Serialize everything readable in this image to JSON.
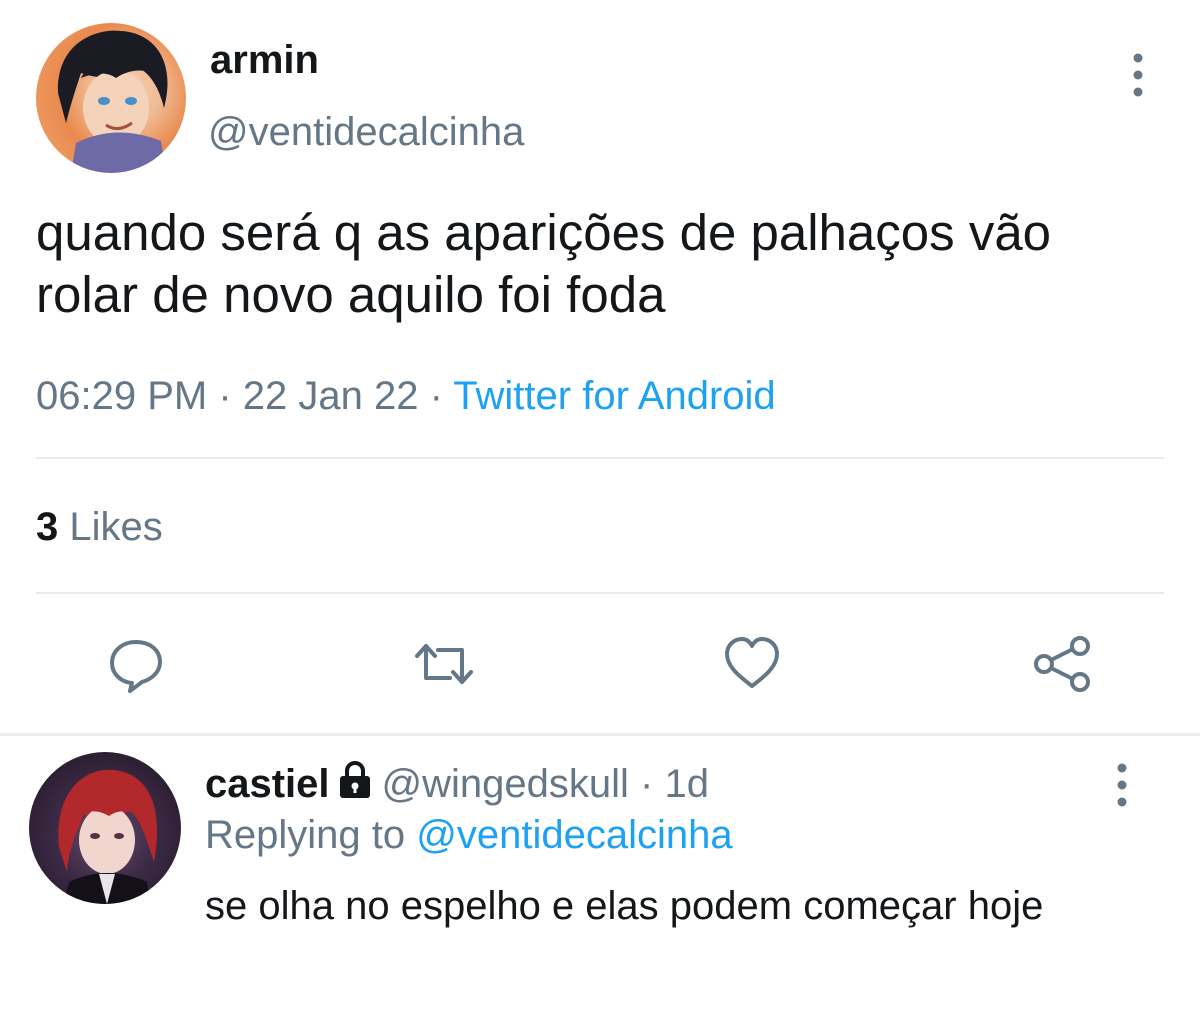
{
  "tweet": {
    "author": {
      "display_name": "armin",
      "handle": "@ventidecalcinha"
    },
    "text": "quando será q as aparições de palhaços vão rolar de novo aquilo foi foda",
    "time": "06:29 PM",
    "separator": " · ",
    "date": "22 Jan 22",
    "source": "Twitter for Android",
    "likes": {
      "count": "3",
      "label": " Likes"
    },
    "actions": [
      "reply-icon",
      "retweet-icon",
      "like-icon",
      "share-icon"
    ]
  },
  "reply": {
    "display_name": "castiel",
    "handle": "@wingedskull",
    "age_separator": " · ",
    "age": "1d",
    "replying_prefix": "Replying to ",
    "replying_to": "@ventidecalcinha",
    "text": "se olha no espelho e elas podem começar hoje",
    "protected_icon": "lock-icon"
  },
  "colors": {
    "text": "#14171a",
    "secondary": "#657786",
    "accent": "#1da1f2",
    "divider": "#e6ecf0"
  }
}
